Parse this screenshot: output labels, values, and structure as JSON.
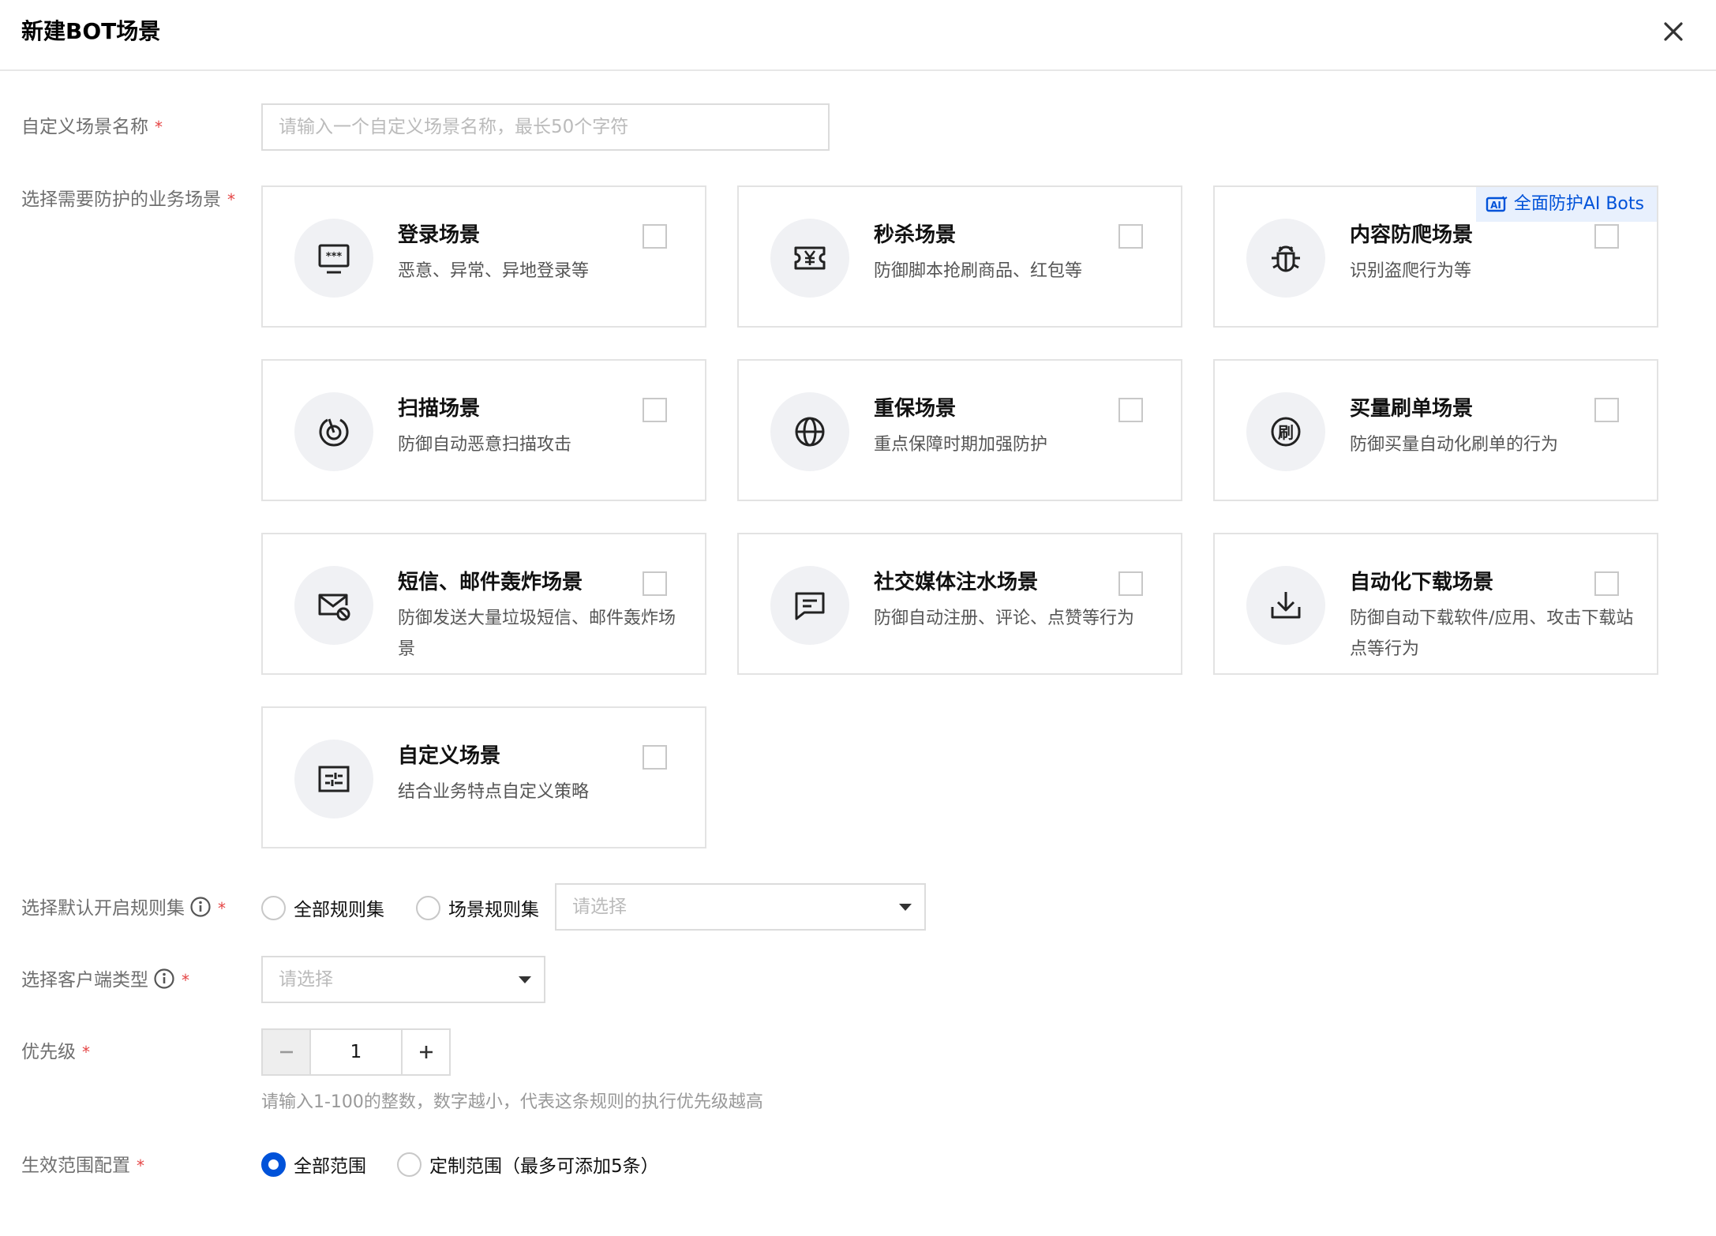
{
  "dialog": {
    "title": "新建BOT场景"
  },
  "form": {
    "name": {
      "label": "自定义场景名称",
      "required_mark": "*",
      "placeholder": "请输入一个自定义场景名称，最长50个字符"
    },
    "scenes": {
      "label": "选择需要防护的业务场景",
      "required_mark": "*",
      "ai_badge": "全面防护AI Bots",
      "items": [
        {
          "title": "登录场景",
          "desc": "恶意、异常、异地登录等",
          "icon": "login-password-icon",
          "checked": false
        },
        {
          "title": "秒杀场景",
          "desc": "防御脚本抢刷商品、红包等",
          "icon": "coupon-icon",
          "checked": false
        },
        {
          "title": "内容防爬场景",
          "desc": "识别盗爬行为等",
          "icon": "bug-icon",
          "checked": false
        },
        {
          "title": "扫描场景",
          "desc": "防御自动恶意扫描攻击",
          "icon": "radar-icon",
          "checked": false
        },
        {
          "title": "重保场景",
          "desc": "重点保障时期加强防护",
          "icon": "globe-icon",
          "checked": false
        },
        {
          "title": "买量刷单场景",
          "desc": "防御买量自动化刷单的行为",
          "icon": "brush-order-icon",
          "checked": false
        },
        {
          "title": "短信、邮件轰炸场景",
          "desc": "防御发送大量垃圾短信、邮件轰炸场景",
          "icon": "mail-block-icon",
          "checked": false
        },
        {
          "title": "社交媒体注水场景",
          "desc": "防御自动注册、评论、点赞等行为",
          "icon": "comment-icon",
          "checked": false
        },
        {
          "title": "自动化下载场景",
          "desc": "防御自动下载软件/应用、攻击下载站点等行为",
          "icon": "download-icon",
          "checked": false
        },
        {
          "title": "自定义场景",
          "desc": "结合业务特点自定义策略",
          "icon": "custom-settings-icon",
          "checked": false
        }
      ]
    },
    "ruleset": {
      "label": "选择默认开启规则集",
      "required_mark": "*",
      "options": [
        {
          "label": "全部规则集",
          "selected": false
        },
        {
          "label": "场景规则集",
          "selected": false
        }
      ],
      "select_placeholder": "请选择"
    },
    "client_type": {
      "label": "选择客户端类型",
      "required_mark": "*",
      "placeholder": "请选择"
    },
    "priority": {
      "label": "优先级",
      "required_mark": "*",
      "value": "1",
      "hint": "请输入1-100的整数，数字越小，代表这条规则的执行优先级越高"
    },
    "scope": {
      "label": "生效范围配置",
      "required_mark": "*",
      "options": [
        {
          "label": "全部范围",
          "selected": true
        },
        {
          "label": "定制范围（最多可添加5条）",
          "selected": false
        }
      ]
    }
  },
  "colors": {
    "primary": "#0052d9",
    "required": "#e54545",
    "badge_bg": "#e8f0fd"
  }
}
